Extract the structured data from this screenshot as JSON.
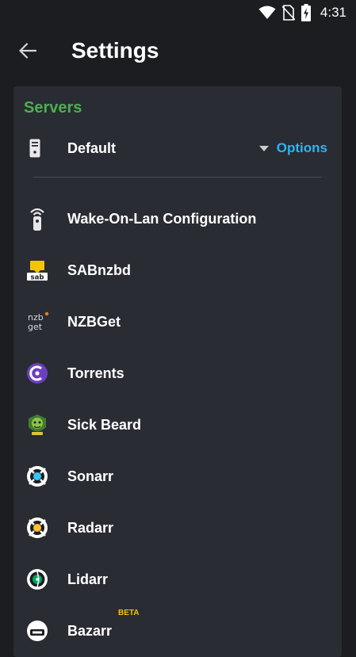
{
  "status_bar": {
    "time": "4:31",
    "icons": [
      "wifi-icon",
      "no-sim-icon",
      "battery-charging-icon"
    ]
  },
  "app_bar": {
    "back_icon": "arrow-left-icon",
    "title": "Settings"
  },
  "servers_card": {
    "section_title": "Servers",
    "server": {
      "icon": "server-icon",
      "name": "Default",
      "options_label": "Options",
      "dropdown_icon": "caret-down-icon"
    },
    "items": [
      {
        "label": "Wake-On-Lan Configuration",
        "icon": "remote-icon"
      },
      {
        "label": "SABnzbd",
        "icon": "sabnzbd-icon"
      },
      {
        "label": "NZBGet",
        "icon": "nzbget-icon"
      },
      {
        "label": "Torrents",
        "icon": "torrents-icon"
      },
      {
        "label": "Sick Beard",
        "icon": "sickbeard-icon"
      },
      {
        "label": "Sonarr",
        "icon": "sonarr-icon"
      },
      {
        "label": "Radarr",
        "icon": "radarr-icon"
      },
      {
        "label": "Lidarr",
        "icon": "lidarr-icon"
      },
      {
        "label": "Bazarr",
        "icon": "bazarr-icon",
        "badge": "BETA"
      }
    ]
  },
  "colors": {
    "background": "#1c1d21",
    "card": "#2a2c33",
    "section_title": "#4caf50",
    "accent": "#29b6f6",
    "beta": "#f5c400"
  }
}
